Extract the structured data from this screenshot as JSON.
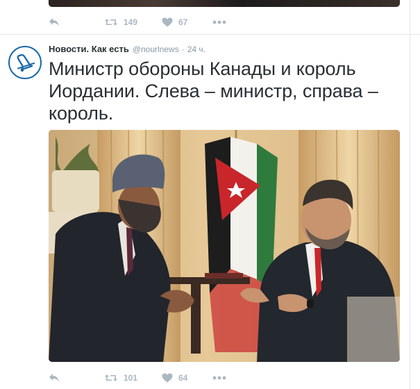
{
  "previous_tweet": {
    "retweet_count": "149",
    "like_count": "67"
  },
  "tweet": {
    "fullname": "Новости. Как есть",
    "username": "@nourlnews",
    "separator": "·",
    "time": "24 ч.",
    "text": "Министр обороны Канады и король Иордании. Слева – министр, справа – король.",
    "retweet_count": "101",
    "like_count": "64"
  },
  "icons": {
    "reply": "reply-icon",
    "retweet": "retweet-icon",
    "like": "heart-icon",
    "more": "more-dots-icon",
    "avatar": "bell-logo-icon"
  },
  "colors": {
    "action_gray": "#aab8c2",
    "text": "#292f33",
    "meta": "#8899a6",
    "avatar_border": "#1b6aa8"
  }
}
